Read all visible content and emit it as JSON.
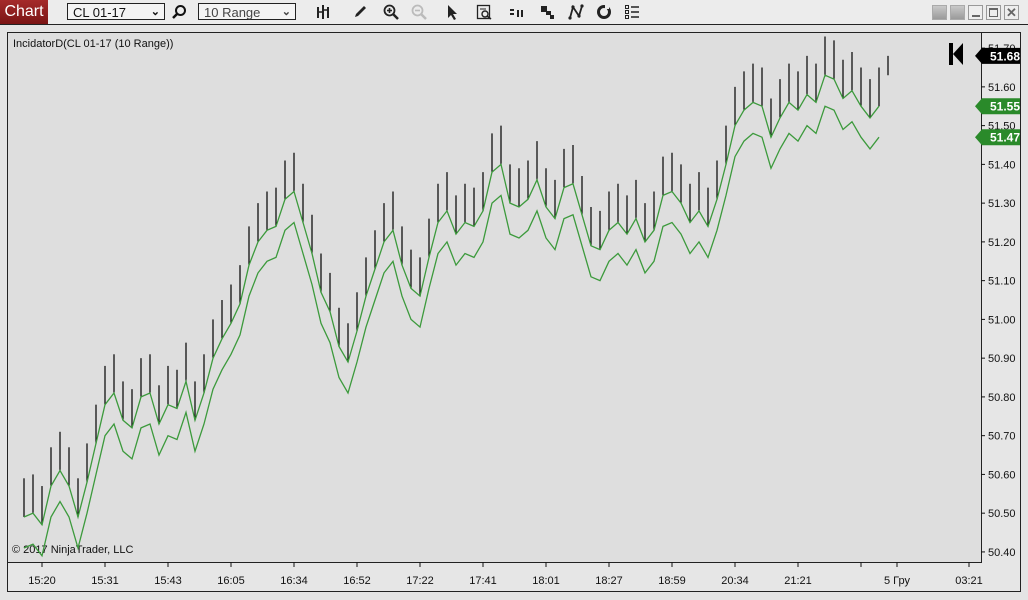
{
  "toolbar": {
    "tab_label": "Chart",
    "instrument": "CL 01-17",
    "bar_type": "10 Range",
    "icons": [
      "search-icon",
      "bar-style-icon",
      "pencil-icon",
      "zoom-in-icon",
      "zoom-out-icon",
      "pointer-icon",
      "data-box-icon",
      "bar-spacing-icon",
      "stacked-squares-icon",
      "drawing-tool-icon",
      "refresh-icon",
      "properties-list-icon"
    ]
  },
  "chart": {
    "indicator_label": "IncidatorD(CL 01-17 (10 Range))",
    "copyright": "© 2017 NinjaTrader, LLC",
    "colors": {
      "bars": "#000000",
      "bands": "#3c9a3c",
      "last_price_marker": "#000000",
      "band_marker": "#2a8a2a",
      "background": "#dedede"
    }
  },
  "chart_data": {
    "type": "line",
    "ylim": [
      50.374,
      51.739
    ],
    "y_ticks": [
      "51.70",
      "51.60",
      "51.50",
      "51.40",
      "51.30",
      "51.20",
      "51.10",
      "51.00",
      "50.90",
      "50.80",
      "50.70",
      "50.60",
      "50.50",
      "50.40"
    ],
    "x_ticks": [
      {
        "bar": 2,
        "label": "15:20"
      },
      {
        "bar": 9,
        "label": "15:31"
      },
      {
        "bar": 16,
        "label": "15:43"
      },
      {
        "bar": 23,
        "label": "16:05"
      },
      {
        "bar": 30,
        "label": "16:34"
      },
      {
        "bar": 37,
        "label": "16:52"
      },
      {
        "bar": 44,
        "label": "17:22"
      },
      {
        "bar": 51,
        "label": "17:41"
      },
      {
        "bar": 58,
        "label": "18:01"
      },
      {
        "bar": 65,
        "label": "18:27"
      },
      {
        "bar": 72,
        "label": "18:59"
      },
      {
        "bar": 79,
        "label": "20:34"
      },
      {
        "bar": 86,
        "label": "21:21"
      },
      {
        "bar": 93,
        "label": ""
      },
      {
        "bar": 97,
        "label": "5 Гру"
      },
      {
        "bar": 105,
        "label": "03:21"
      }
    ],
    "bars": {
      "high": [
        50.59,
        50.6,
        50.57,
        50.67,
        50.71,
        50.67,
        50.59,
        50.68,
        50.78,
        50.88,
        50.91,
        50.84,
        50.82,
        50.9,
        50.91,
        50.83,
        50.88,
        50.87,
        50.94,
        50.84,
        50.91,
        51.0,
        51.05,
        51.09,
        51.14,
        51.24,
        51.3,
        51.33,
        51.34,
        51.41,
        51.43,
        51.35,
        51.27,
        51.17,
        51.12,
        51.03,
        50.99,
        51.07,
        51.16,
        51.23,
        51.3,
        51.33,
        51.24,
        51.18,
        51.16,
        51.26,
        51.35,
        51.38,
        51.32,
        51.35,
        51.34,
        51.38,
        51.48,
        51.5,
        51.4,
        51.39,
        51.41,
        51.46,
        51.39,
        51.36,
        51.44,
        51.45,
        51.37,
        51.29,
        51.28,
        51.33,
        51.35,
        51.32,
        51.36,
        51.3,
        51.33,
        51.42,
        51.43,
        51.4,
        51.35,
        51.38,
        51.34,
        51.41,
        51.5,
        51.6,
        51.64,
        51.66,
        51.65,
        51.57,
        51.62,
        51.66,
        51.64,
        51.68,
        51.66,
        51.73,
        51.72,
        51.67,
        51.69,
        51.65,
        51.62,
        51.65,
        51.68
      ],
      "low": [
        50.49,
        50.5,
        50.47,
        50.57,
        50.61,
        50.57,
        50.49,
        50.58,
        50.68,
        50.78,
        50.81,
        50.74,
        50.72,
        50.8,
        50.81,
        50.73,
        50.78,
        50.77,
        50.84,
        50.74,
        50.81,
        50.9,
        50.95,
        50.99,
        51.04,
        51.14,
        51.2,
        51.23,
        51.24,
        51.31,
        51.33,
        51.25,
        51.17,
        51.07,
        51.02,
        50.93,
        50.89,
        50.97,
        51.06,
        51.13,
        51.2,
        51.23,
        51.14,
        51.08,
        51.06,
        51.16,
        51.25,
        51.28,
        51.22,
        51.25,
        51.24,
        51.28,
        51.38,
        51.4,
        51.3,
        51.29,
        51.31,
        51.36,
        51.29,
        51.26,
        51.34,
        51.35,
        51.27,
        51.19,
        51.18,
        51.23,
        51.25,
        51.22,
        51.26,
        51.2,
        51.23,
        51.32,
        51.33,
        51.3,
        51.25,
        51.28,
        51.24,
        51.31,
        51.4,
        51.5,
        51.54,
        51.56,
        51.55,
        51.47,
        51.52,
        51.56,
        51.54,
        51.58,
        51.56,
        51.63,
        51.62,
        51.57,
        51.59,
        51.55,
        51.52,
        51.55,
        51.63
      ]
    },
    "series": [
      {
        "values": [
          50.49,
          50.5,
          50.47,
          50.57,
          50.61,
          50.57,
          50.49,
          50.58,
          50.68,
          50.78,
          50.81,
          50.74,
          50.72,
          50.8,
          50.81,
          50.73,
          50.78,
          50.77,
          50.84,
          50.74,
          50.81,
          50.9,
          50.95,
          50.99,
          51.04,
          51.14,
          51.2,
          51.23,
          51.24,
          51.31,
          51.33,
          51.25,
          51.17,
          51.07,
          51.02,
          50.93,
          50.89,
          50.97,
          51.06,
          51.13,
          51.2,
          51.23,
          51.14,
          51.08,
          51.06,
          51.16,
          51.25,
          51.28,
          51.22,
          51.25,
          51.24,
          51.28,
          51.38,
          51.4,
          51.3,
          51.29,
          51.31,
          51.36,
          51.29,
          51.26,
          51.34,
          51.35,
          51.27,
          51.19,
          51.18,
          51.23,
          51.25,
          51.22,
          51.26,
          51.2,
          51.23,
          51.32,
          51.33,
          51.3,
          51.25,
          51.28,
          51.24,
          51.31,
          51.4,
          51.5,
          51.54,
          51.56,
          51.55,
          51.47,
          51.52,
          51.56,
          51.54,
          51.58,
          51.56,
          51.63,
          51.62,
          51.57,
          51.59,
          51.55,
          51.52,
          51.55
        ]
      },
      {
        "values": [
          50.41,
          50.42,
          50.39,
          50.49,
          50.53,
          50.49,
          50.41,
          50.5,
          50.6,
          50.7,
          50.73,
          50.66,
          50.64,
          50.72,
          50.73,
          50.65,
          50.7,
          50.69,
          50.76,
          50.66,
          50.73,
          50.82,
          50.87,
          50.91,
          50.96,
          51.06,
          51.12,
          51.15,
          51.16,
          51.23,
          51.25,
          51.17,
          51.09,
          50.99,
          50.94,
          50.85,
          50.81,
          50.89,
          50.98,
          51.05,
          51.12,
          51.15,
          51.06,
          51.0,
          50.98,
          51.08,
          51.17,
          51.2,
          51.14,
          51.17,
          51.16,
          51.2,
          51.3,
          51.32,
          51.22,
          51.21,
          51.23,
          51.28,
          51.21,
          51.18,
          51.26,
          51.27,
          51.19,
          51.11,
          51.1,
          51.15,
          51.17,
          51.14,
          51.18,
          51.12,
          51.15,
          51.24,
          51.25,
          51.22,
          51.17,
          51.2,
          51.16,
          51.23,
          51.32,
          51.42,
          51.46,
          51.48,
          51.47,
          51.39,
          51.44,
          51.48,
          51.46,
          51.5,
          51.48,
          51.55,
          51.54,
          51.49,
          51.51,
          51.47,
          51.44,
          51.47
        ]
      }
    ],
    "price_markers": [
      {
        "label": "51.68",
        "value": 51.68,
        "color": "#000000"
      },
      {
        "label": "51.55",
        "value": 51.55,
        "color": "#2a8a2a"
      },
      {
        "label": "51.47",
        "value": 51.47,
        "color": "#2a8a2a"
      }
    ]
  }
}
